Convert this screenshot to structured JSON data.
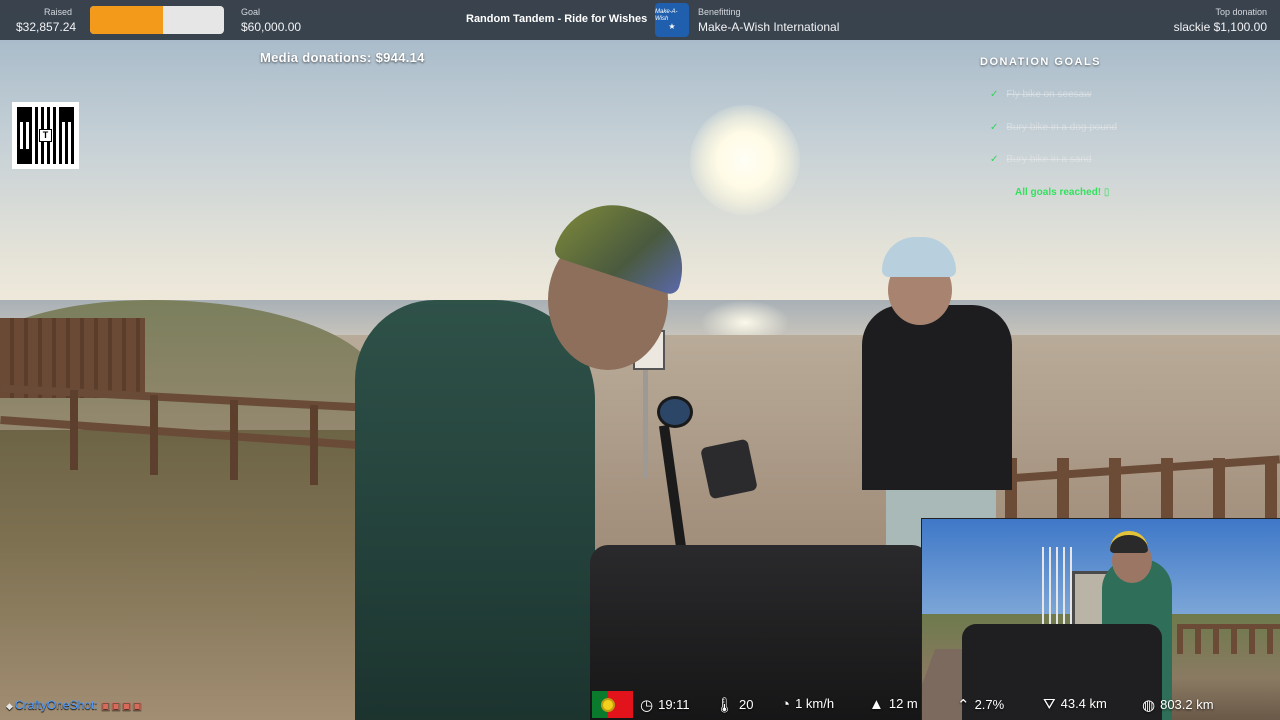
{
  "topbar": {
    "raised_label": "Raised",
    "raised_value": "$32,857.24",
    "raised_progress_fraction": 0.548,
    "goal_label": "Goal",
    "goal_value": "$60,000.00",
    "title": "Random Tandem - Ride for Wishes",
    "charity_logo_text": "Make-A-Wish",
    "benefitting_label": "Benefitting",
    "benefitting_value": "Make-A-Wish International",
    "top_donation_label": "Top donation",
    "top_donation_value": "slackie $1,100.00",
    "colors": {
      "bar_bg": "#303842",
      "progress_fill": "#f39a1a",
      "logo_bg": "#1f5fae"
    }
  },
  "media_donations": "Media donations: $944.14",
  "qr": {
    "icon": "qr-code-icon",
    "center_letter": "T"
  },
  "donation_goals": {
    "title": "DONATION GOALS",
    "items": [
      {
        "check": "✓",
        "text": "Fly bike on seesaw"
      },
      {
        "check": "✓",
        "text": "Bury bike in a dog pound"
      },
      {
        "check": "✓",
        "text": "Bury bike in a sand"
      }
    ],
    "done_text": "All goals reached! ▯",
    "colors": {
      "check": "#32d35c",
      "done": "#34e05e"
    }
  },
  "chat": {
    "username": "CraftyOneShot:",
    "emotes": "▣▣▣▣"
  },
  "stats": {
    "flag": "portugal-flag",
    "time": "19:11",
    "temperature": "20",
    "speed": "1 km/h",
    "elevation": "12 m",
    "grade": "2.7%",
    "distance_today": "43.4 km",
    "distance_total": "803.2 km"
  }
}
